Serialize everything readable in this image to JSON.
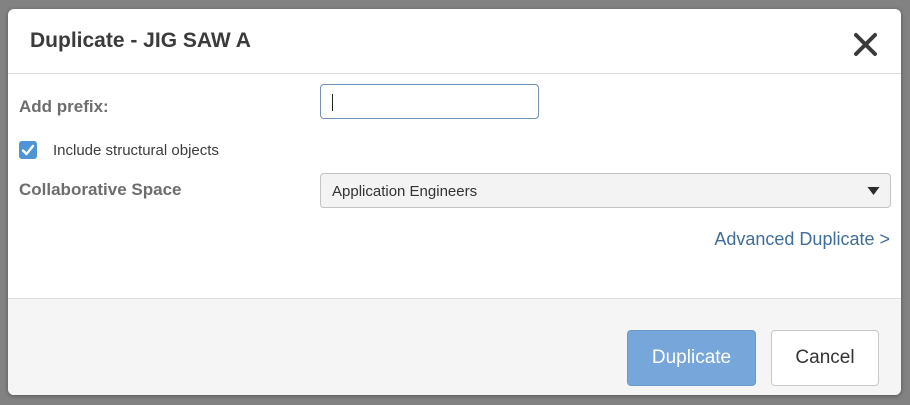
{
  "dialog": {
    "title": "Duplicate - JIG SAW A",
    "close_icon": "close-icon"
  },
  "form": {
    "prefix_label": "Add prefix:",
    "prefix_value": "",
    "include_structural": {
      "label": "Include structural objects",
      "checked": true
    },
    "collab_space_label": "Collaborative Space",
    "collab_space_value": "Application Engineers",
    "advanced_link": "Advanced Duplicate >"
  },
  "footer": {
    "primary_label": "Duplicate",
    "cancel_label": "Cancel"
  },
  "colors": {
    "accent": "#4f94d4",
    "primary_button": "#77a7da",
    "link": "#3f6e9a"
  }
}
